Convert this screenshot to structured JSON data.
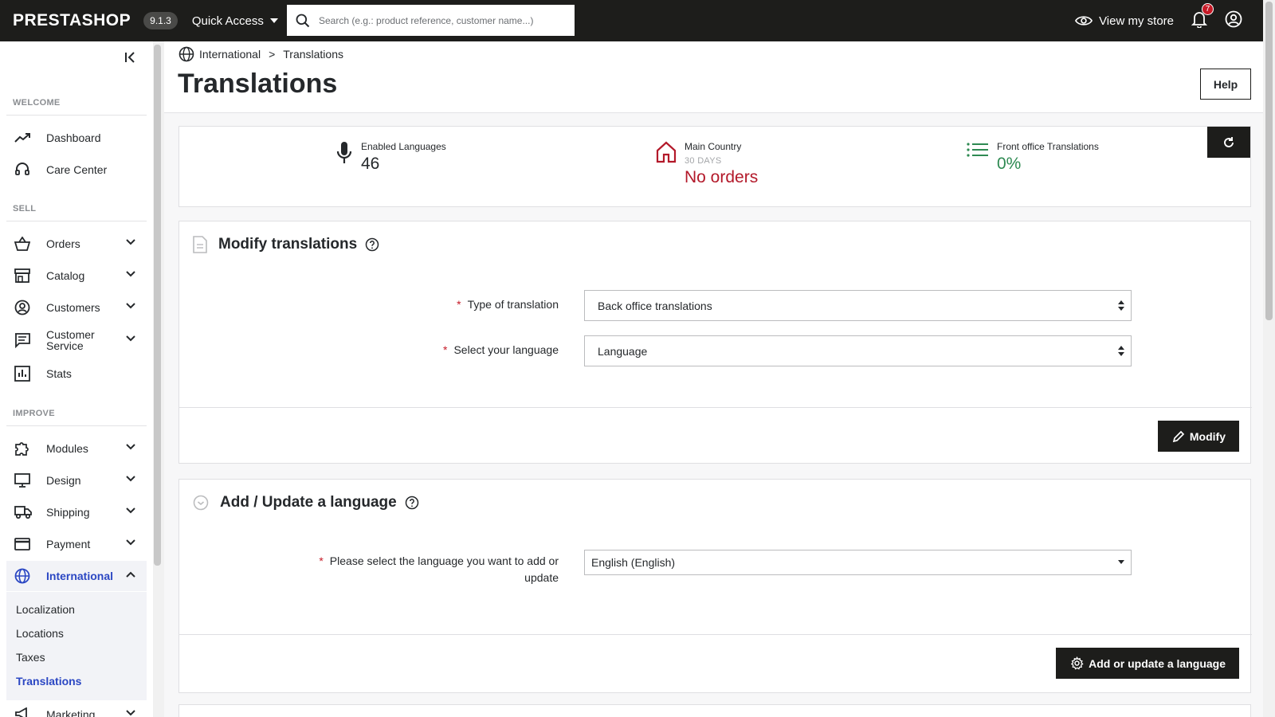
{
  "topbar": {
    "logo": "PRESTASHOP",
    "version": "9.1.3",
    "quick_access": "Quick Access",
    "search_placeholder": "Search (e.g.: product reference, customer name...)",
    "view_store": "View my store",
    "notification_count": "7"
  },
  "sidebar": {
    "sections": {
      "welcome": "WELCOME",
      "sell": "SELL",
      "improve": "IMPROVE"
    },
    "items": {
      "dashboard": "Dashboard",
      "care_center": "Care Center",
      "orders": "Orders",
      "catalog": "Catalog",
      "customers": "Customers",
      "customer_service_1": "Customer",
      "customer_service_2": "Service",
      "stats": "Stats",
      "modules": "Modules",
      "design": "Design",
      "shipping": "Shipping",
      "payment": "Payment",
      "international": "International",
      "marketing": "Marketing"
    },
    "subitems": {
      "localization": "Localization",
      "locations": "Locations",
      "taxes": "Taxes",
      "translations": "Translations"
    }
  },
  "header": {
    "breadcrumb_parent": "International",
    "breadcrumb_sep": ">",
    "breadcrumb_current": "Translations",
    "title": "Translations",
    "help": "Help"
  },
  "kpis": {
    "languages": {
      "label": "Enabled Languages",
      "value": "46"
    },
    "country": {
      "label": "Main Country",
      "sub": "30 DAYS",
      "value": "No orders"
    },
    "front": {
      "label": "Front office Translations",
      "value": "0%"
    },
    "colors": {
      "country": "#b3192a",
      "front": "#2e8a52"
    }
  },
  "modify_card": {
    "title": "Modify translations",
    "type_label": "Type of translation",
    "type_value": "Back office translations",
    "language_label": "Select your language",
    "language_value": "Language",
    "button": "Modify"
  },
  "language_card": {
    "title": "Add / Update a language",
    "label_line1": "Please select the language you want to add or",
    "label_line2": "update",
    "value": "English (English)",
    "button": "Add or update a language"
  },
  "required_mark": "*"
}
